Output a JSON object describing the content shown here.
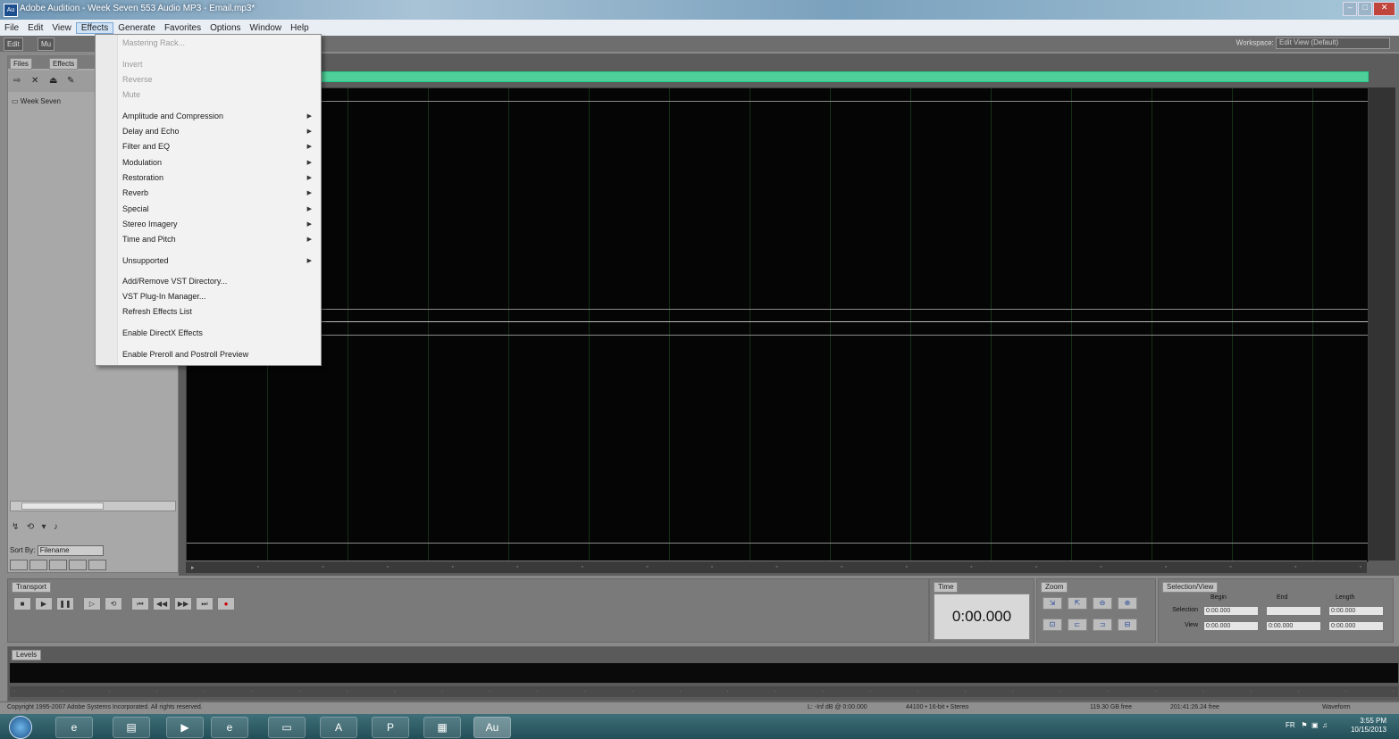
{
  "window": {
    "title": "Adobe Audition - Week Seven 553 Audio MP3 - Email.mp3*"
  },
  "menubar": [
    "File",
    "Edit",
    "View",
    "Effects",
    "Generate",
    "Favorites",
    "Options",
    "Window",
    "Help"
  ],
  "toolbar": {
    "edit_view": "Edit",
    "multitrack": "Mu",
    "workspace_label": "Workspace:",
    "workspace_value": "Edit View (Default)"
  },
  "file_panel": {
    "tabs": [
      "Files",
      "Effects"
    ],
    "item": "Week Seven",
    "sort_by_label": "Sort By:",
    "sort_by_value": "Filename"
  },
  "effects_menu": {
    "disabled_top": [
      "Mastering Rack...",
      "Invert",
      "Reverse",
      "Mute"
    ],
    "submenus": [
      "Amplitude and Compression",
      "Delay and Echo",
      "Filter and EQ",
      "Modulation",
      "Restoration",
      "Reverb",
      "Special",
      "Stereo Imagery",
      "Time and Pitch"
    ],
    "unsupported": "Unsupported",
    "vst": [
      "Add/Remove VST Directory...",
      "VST Plug-In Manager...",
      "Refresh Effects List"
    ],
    "directx": "Enable DirectX Effects",
    "preroll": "Enable Preroll and Postroll Preview"
  },
  "panels": {
    "transport": "Transport",
    "time": "Time",
    "zoom": "Zoom",
    "selection_view": "Selection/View",
    "levels": "Levels"
  },
  "time_display": "0:00.000",
  "selection_view": {
    "headers": [
      "Begin",
      "End",
      "Length"
    ],
    "selection_label": "Selection",
    "view_label": "View",
    "selection": [
      "0:00.000",
      "",
      "0:00.000"
    ],
    "view": [
      "0:00.000",
      "0:00.000",
      "0:00.000"
    ]
  },
  "status_bar": {
    "copyright": "Copyright 1995-2007 Adobe Systems Incorporated. All rights reserved.",
    "level": "L: -Inf dB @ 0:00.000",
    "format": "44100 • 16-bit • Stereo",
    "disk_free": "119.30 GB free",
    "time_free": "201:41:26.24 free",
    "view_mode": "Waveform"
  },
  "taskbar": {
    "lang": "FR",
    "time": "3:55 PM",
    "date": "10/15/2013",
    "active_app": "Au"
  },
  "colors": {
    "overview_bar": "#4fd09a",
    "waveform_bg": "#050505",
    "menu_bg": "#f2f2f2"
  }
}
